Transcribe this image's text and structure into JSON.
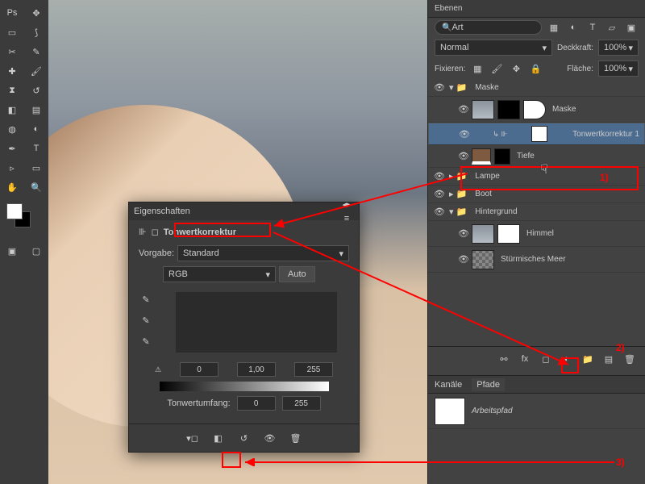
{
  "panels": {
    "layers_title": "Ebenen",
    "channels_title": "Kanäle",
    "paths_title": "Pfade",
    "work_path": "Arbeitspfad",
    "search_sort": "Art",
    "blend_mode": "Normal",
    "opacity_label": "Deckkraft:",
    "opacity_value": "100%",
    "fill_label": "Fläche:",
    "fill_value": "100%",
    "lock_label": "Fixieren:"
  },
  "layers": {
    "group_maske": "Maske",
    "layer_maske": "Maske",
    "layer_levels": "Tonwertkorrektur 1",
    "layer_tiefe": "Tiefe",
    "group_lampe": "Lampe",
    "group_boot": "Boot",
    "group_hg": "Hintergrund",
    "layer_himmel": "Himmel",
    "layer_meer": "Stürmisches Meer"
  },
  "properties": {
    "panel_title": "Eigenschaften",
    "adj_title": "Tonwertkorrektur",
    "preset_label": "Vorgabe:",
    "preset_value": "Standard",
    "channel_value": "RGB",
    "auto_button": "Auto",
    "shadow": "0",
    "mid": "1,00",
    "highlight": "255",
    "output_label": "Tonwertumfang:",
    "out_low": "0",
    "out_high": "255"
  },
  "annotations": {
    "one": "1)",
    "two": "2)",
    "three": "3)"
  }
}
